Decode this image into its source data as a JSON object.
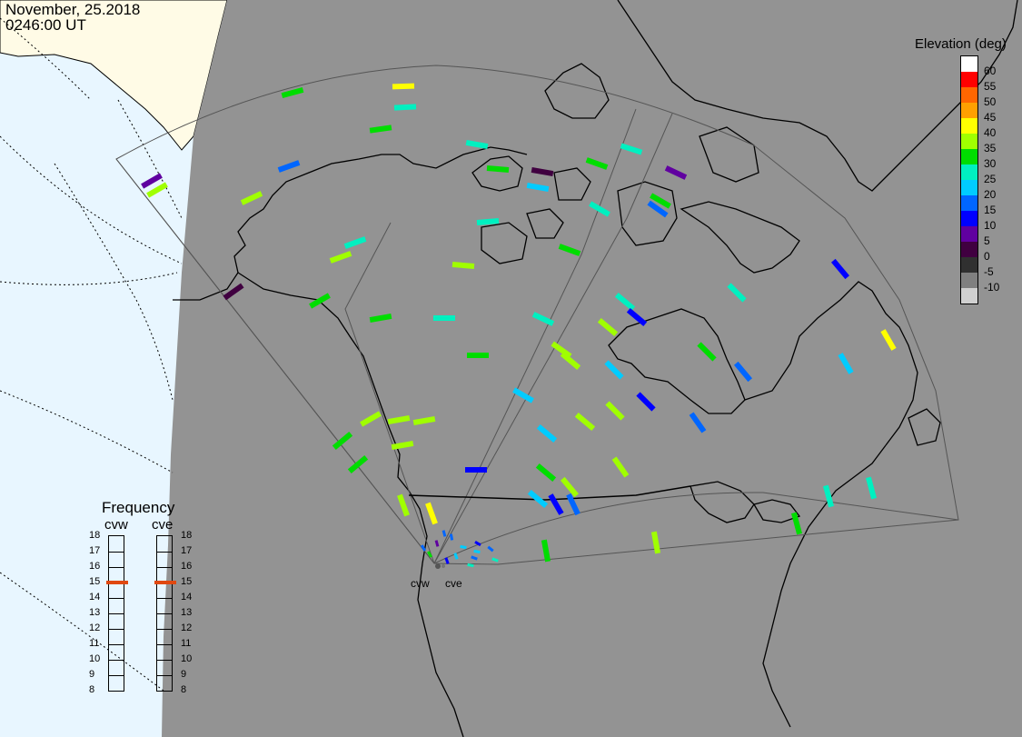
{
  "header": {
    "date": "November, 25.2018",
    "time": "0246:00 UT"
  },
  "legend": {
    "title": "Elevation (deg)",
    "labels": [
      "60",
      "55",
      "50",
      "45",
      "40",
      "35",
      "30",
      "25",
      "20",
      "15",
      "10",
      "5",
      "0",
      "-5",
      "-10"
    ],
    "colors": [
      "#ffffff",
      "#ff0000",
      "#ff6600",
      "#ffa000",
      "#ffff00",
      "#a0ff00",
      "#00dd00",
      "#00f0c0",
      "#00ccff",
      "#0066ff",
      "#0000ff",
      "#6000a0",
      "#400040",
      "#303030",
      "#808080",
      "#d0d0d0"
    ]
  },
  "frequency": {
    "title": "Frequency",
    "radars": [
      "cvw",
      "cve"
    ],
    "ticks": [
      "18",
      "17",
      "16",
      "15",
      "14",
      "13",
      "12",
      "11",
      "10",
      "9",
      "8"
    ],
    "cvw_mhz": 15,
    "cve_mhz": 15
  },
  "radars": {
    "west_label": "cvw",
    "east_label": "cve"
  },
  "colors": {
    "ocean": "#e8f6ff",
    "land_day": "#fffbe6",
    "night": "#939393",
    "indicator": "#e04810"
  },
  "map_data": {
    "projection": "polar stereographic, north-up over North America",
    "fov_regions": [
      "cvw west beam fan",
      "cve east beam fan"
    ],
    "scatter_points": [
      {
        "color_idx": 6,
        "a": 322,
        "b": 102,
        "ang": -15
      },
      {
        "color_idx": 4,
        "a": 444,
        "b": 95,
        "ang": -2
      },
      {
        "color_idx": 7,
        "a": 446,
        "b": 118,
        "ang": -3
      },
      {
        "color_idx": 6,
        "a": 419,
        "b": 142,
        "ang": -8
      },
      {
        "color_idx": 7,
        "a": 525,
        "b": 159,
        "ang": 10
      },
      {
        "color_idx": 7,
        "a": 695,
        "b": 164,
        "ang": 18
      },
      {
        "color_idx": 9,
        "a": 318,
        "b": 183,
        "ang": -20
      },
      {
        "color_idx": 11,
        "a": 167,
        "b": 199,
        "ang": -30
      },
      {
        "color_idx": 5,
        "a": 173,
        "b": 209,
        "ang": -30
      },
      {
        "color_idx": 6,
        "a": 548,
        "b": 186,
        "ang": 5
      },
      {
        "color_idx": 12,
        "a": 597,
        "b": 189,
        "ang": 10
      },
      {
        "color_idx": 6,
        "a": 657,
        "b": 180,
        "ang": 20
      },
      {
        "color_idx": 11,
        "a": 744,
        "b": 190,
        "ang": 25
      },
      {
        "color_idx": 8,
        "a": 592,
        "b": 206,
        "ang": 10
      },
      {
        "color_idx": 5,
        "a": 277,
        "b": 218,
        "ang": -25
      },
      {
        "color_idx": 6,
        "a": 727,
        "b": 221,
        "ang": 30
      },
      {
        "color_idx": 9,
        "a": 724,
        "b": 230,
        "ang": 35
      },
      {
        "color_idx": 7,
        "a": 660,
        "b": 230,
        "ang": 30
      },
      {
        "color_idx": 7,
        "a": 537,
        "b": 244,
        "ang": -5
      },
      {
        "color_idx": 7,
        "a": 391,
        "b": 267,
        "ang": -20
      },
      {
        "color_idx": 6,
        "a": 627,
        "b": 275,
        "ang": 20
      },
      {
        "color_idx": 5,
        "a": 375,
        "b": 283,
        "ang": -20
      },
      {
        "color_idx": 5,
        "a": 510,
        "b": 292,
        "ang": 5
      },
      {
        "color_idx": 12,
        "a": 257,
        "b": 321,
        "ang": -35
      },
      {
        "color_idx": 10,
        "a": 925,
        "b": 296,
        "ang": 50
      },
      {
        "color_idx": 7,
        "a": 811,
        "b": 322,
        "ang": 45
      },
      {
        "color_idx": 6,
        "a": 352,
        "b": 331,
        "ang": -30
      },
      {
        "color_idx": 7,
        "a": 688,
        "b": 332,
        "ang": 40
      },
      {
        "color_idx": 10,
        "a": 701,
        "b": 349,
        "ang": 40
      },
      {
        "color_idx": 6,
        "a": 419,
        "b": 350,
        "ang": -10
      },
      {
        "color_idx": 7,
        "a": 489,
        "b": 350,
        "ang": 0
      },
      {
        "color_idx": 7,
        "a": 598,
        "b": 351,
        "ang": 25
      },
      {
        "color_idx": 5,
        "a": 669,
        "b": 360,
        "ang": 40
      },
      {
        "color_idx": 4,
        "a": 978,
        "b": 374,
        "ang": 60
      },
      {
        "color_idx": 6,
        "a": 526,
        "b": 391,
        "ang": 0
      },
      {
        "color_idx": 5,
        "a": 618,
        "b": 385,
        "ang": 35
      },
      {
        "color_idx": 5,
        "a": 628,
        "b": 397,
        "ang": 40
      },
      {
        "color_idx": 6,
        "a": 778,
        "b": 387,
        "ang": 45
      },
      {
        "color_idx": 8,
        "a": 931,
        "b": 400,
        "ang": 60
      },
      {
        "color_idx": 8,
        "a": 676,
        "b": 407,
        "ang": 45
      },
      {
        "color_idx": 9,
        "a": 818,
        "b": 409,
        "ang": 50
      },
      {
        "color_idx": 8,
        "a": 576,
        "b": 435,
        "ang": 30
      },
      {
        "color_idx": 10,
        "a": 711,
        "b": 442,
        "ang": 45
      },
      {
        "color_idx": 5,
        "a": 677,
        "b": 452,
        "ang": 45
      },
      {
        "color_idx": 5,
        "a": 644,
        "b": 464,
        "ang": 40
      },
      {
        "color_idx": 9,
        "a": 768,
        "b": 465,
        "ang": 55
      },
      {
        "color_idx": 5,
        "a": 408,
        "b": 461,
        "ang": -30
      },
      {
        "color_idx": 5,
        "a": 439,
        "b": 462,
        "ang": -10
      },
      {
        "color_idx": 5,
        "a": 467,
        "b": 463,
        "ang": -10
      },
      {
        "color_idx": 8,
        "a": 602,
        "b": 477,
        "ang": 40
      },
      {
        "color_idx": 6,
        "a": 377,
        "b": 485,
        "ang": -40
      },
      {
        "color_idx": 5,
        "a": 443,
        "b": 490,
        "ang": -10
      },
      {
        "color_idx": 5,
        "a": 683,
        "b": 514,
        "ang": 55
      },
      {
        "color_idx": 6,
        "a": 394,
        "b": 511,
        "ang": -40
      },
      {
        "color_idx": 10,
        "a": 524,
        "b": 517,
        "ang": 0
      },
      {
        "color_idx": 6,
        "a": 601,
        "b": 520,
        "ang": 40
      },
      {
        "color_idx": 5,
        "a": 627,
        "b": 536,
        "ang": 50
      },
      {
        "color_idx": 7,
        "a": 959,
        "b": 537,
        "ang": 75
      },
      {
        "color_idx": 7,
        "a": 912,
        "b": 546,
        "ang": 75
      },
      {
        "color_idx": 8,
        "a": 592,
        "b": 549,
        "ang": 40
      },
      {
        "color_idx": 10,
        "a": 612,
        "b": 555,
        "ang": 60
      },
      {
        "color_idx": 9,
        "a": 631,
        "b": 555,
        "ang": 65
      },
      {
        "color_idx": 6,
        "a": 877,
        "b": 576,
        "ang": 75
      },
      {
        "color_idx": 5,
        "a": 722,
        "b": 597,
        "ang": 80
      },
      {
        "color_idx": 6,
        "a": 601,
        "b": 606,
        "ang": 80
      },
      {
        "color_idx": 4,
        "a": 475,
        "b": 565,
        "ang": 70
      },
      {
        "color_idx": 5,
        "a": 444,
        "b": 556,
        "ang": 70
      },
      {
        "color_idx": 9,
        "a": 489,
        "b": 587,
        "ang": 75
      },
      {
        "color_idx": 11,
        "a": 481,
        "b": 598,
        "ang": 75
      },
      {
        "color_idx": 9,
        "a": 497,
        "b": 591,
        "ang": 80
      },
      {
        "color_idx": 8,
        "a": 510,
        "b": 602,
        "ang": 10
      },
      {
        "color_idx": 10,
        "a": 526,
        "b": 598,
        "ang": 30
      },
      {
        "color_idx": 9,
        "a": 540,
        "b": 604,
        "ang": 40
      },
      {
        "color_idx": 8,
        "a": 525,
        "b": 607,
        "ang": 10
      },
      {
        "color_idx": 9,
        "a": 466,
        "b": 603,
        "ang": 60
      },
      {
        "color_idx": 6,
        "a": 473,
        "b": 610,
        "ang": 60
      },
      {
        "color_idx": 8,
        "a": 502,
        "b": 612,
        "ang": 70
      },
      {
        "color_idx": 9,
        "a": 522,
        "b": 614,
        "ang": 20
      },
      {
        "color_idx": 7,
        "a": 545,
        "b": 616,
        "ang": 20
      },
      {
        "color_idx": 7,
        "a": 518,
        "b": 622,
        "ang": 10
      },
      {
        "color_idx": 10,
        "a": 492,
        "b": 617,
        "ang": 70
      }
    ]
  }
}
